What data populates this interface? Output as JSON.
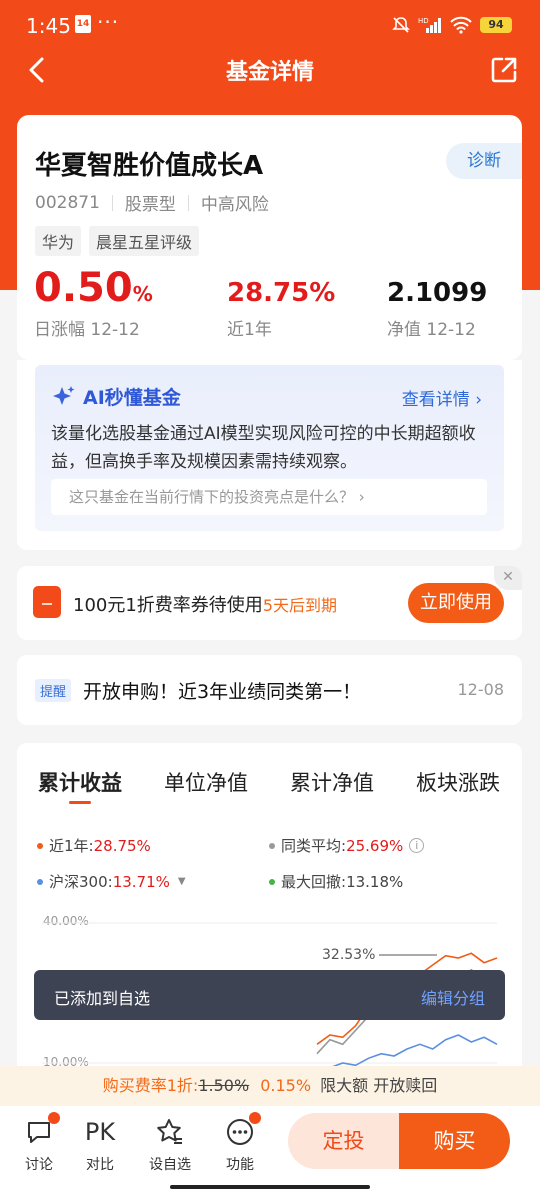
{
  "status": {
    "time": "1:45",
    "cal_day": "14",
    "dots": "···",
    "battery": "94",
    "net": "HD"
  },
  "nav": {
    "title": "基金详情"
  },
  "fund": {
    "name": "华夏智胜价值成长A",
    "diagnose": "诊断",
    "code": "002871",
    "type": "股票型",
    "risk": "中高风险",
    "tags": [
      "华为",
      "晨星五星评级"
    ],
    "daily_change": "0.50",
    "daily_unit": "%",
    "daily_label": "日涨幅 12-12",
    "year_return": "28.75%",
    "year_label": "近1年",
    "nav_value": "2.1099",
    "nav_label": "净值 12-12"
  },
  "ai": {
    "title": "AI秒懂基金",
    "more": "查看详情",
    "summary": "该量化选股基金通过AI模型实现风险可控的中长期超额收益，但高换手率及规模因素需持续观察。",
    "question": "这只基金在当前行情下的投资亮点是什么？"
  },
  "coupon": {
    "text": "100元1折费率券待使用",
    "expire": "5天后到期",
    "button": "立即使用",
    "close": "✕"
  },
  "remind": {
    "tag": "提醒",
    "text": "开放申购！近3年业绩同类第一！",
    "date": "12-08"
  },
  "chart_tabs": [
    "累计收益",
    "单位净值",
    "累计净值",
    "板块涨跌"
  ],
  "legend": {
    "fund_label": "近1年:",
    "fund_value": "28.75%",
    "peer_label": "同类平均:",
    "peer_value": "25.69%",
    "index_label": "沪深300:",
    "index_value": "13.71%",
    "drawdown_label": "最大回撤:",
    "drawdown_value": "13.18%"
  },
  "chart_data": {
    "type": "line",
    "ylim": [
      10,
      40
    ],
    "yticks": [
      "40.00%",
      "10.00%"
    ],
    "annotation": "32.53%",
    "series": [
      {
        "name": "近1年",
        "color": "#f25c16",
        "values": [
          14,
          16,
          15.5,
          18,
          22,
          24,
          23,
          27,
          29,
          31,
          33,
          32.5,
          33.5,
          31.5,
          32.5
        ]
      },
      {
        "name": "同类平均",
        "color": "#999999",
        "values": [
          12,
          15,
          14,
          17,
          20,
          22,
          21,
          24,
          26,
          28,
          29,
          28,
          30,
          28,
          29
        ]
      },
      {
        "name": "沪深300",
        "color": "#5b8fe0",
        "values": [
          8,
          9,
          10,
          9.5,
          11,
          12,
          11.5,
          13,
          14,
          13,
          15,
          16,
          14.5,
          15.5,
          14
        ]
      }
    ]
  },
  "toast": {
    "text": "已添加到自选",
    "action": "编辑分组"
  },
  "fee": {
    "prefix": "购买费率1折:",
    "old": "1.50%",
    "new": "0.15%",
    "suffix": "限大额 开放赎回"
  },
  "bottom": {
    "items": [
      {
        "label": "讨论"
      },
      {
        "label": "对比",
        "glyph": "PK"
      },
      {
        "label": "设自选"
      },
      {
        "label": "功能"
      }
    ],
    "fixed": "定投",
    "buy": "购买"
  },
  "colors": {
    "brand": "#f24a18",
    "up": "#e21b1b",
    "ai_blue": "#2f58d6"
  }
}
